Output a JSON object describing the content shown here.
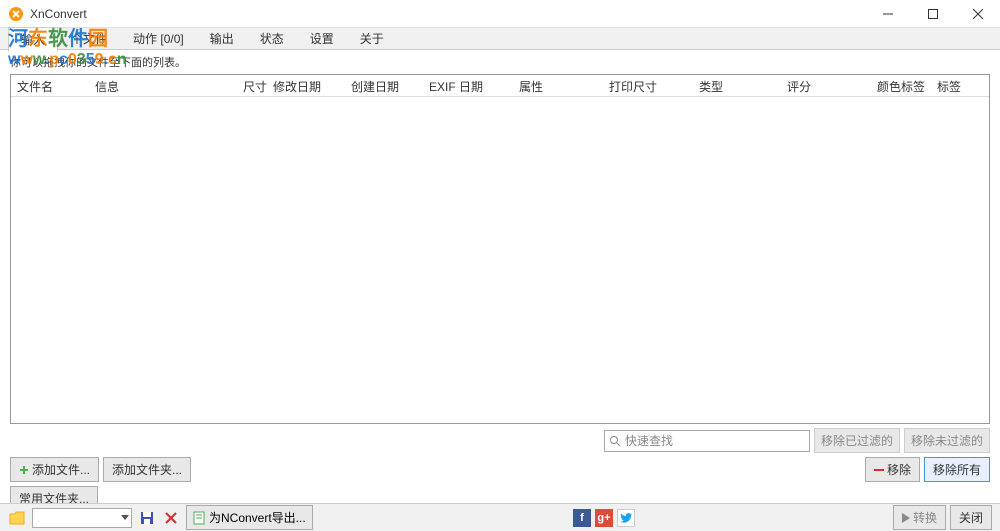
{
  "window": {
    "title": "XnConvert"
  },
  "watermark": {
    "title_chars": [
      "河",
      "东",
      "软",
      "件",
      "园"
    ],
    "url_chars": [
      "w",
      "w",
      "w",
      ".",
      "p",
      "c",
      "0",
      "3",
      "5",
      "9",
      ".",
      "c",
      "n"
    ]
  },
  "tabs": {
    "input": "输入",
    "files_count": "个文件",
    "actions": "动作 [0/0]",
    "output": "输出",
    "status": "状态",
    "settings": "设置",
    "about": "关于"
  },
  "hint": "你可以拖拽你的文件至下面的列表。",
  "columns": {
    "filename": "文件名",
    "info": "信息",
    "size": "尺寸",
    "modified": "修改日期",
    "created": "创建日期",
    "exif_date": "EXIF 日期",
    "attributes": "属性",
    "print_size": "打印尺寸",
    "type": "类型",
    "rating": "评分",
    "color_label": "颜色标签",
    "label": "标签"
  },
  "search": {
    "placeholder": "快速查找"
  },
  "filter_buttons": {
    "remove_filtered": "移除已过滤的",
    "remove_unfiltered": "移除未过滤的"
  },
  "actions": {
    "add_files": "添加文件...",
    "add_folder": "添加文件夹...",
    "common_files": "常用文件夹...",
    "remove": "移除",
    "remove_all": "移除所有"
  },
  "bottom": {
    "export_label": "为NConvert导出...",
    "convert": "转换",
    "close": "关闭"
  }
}
